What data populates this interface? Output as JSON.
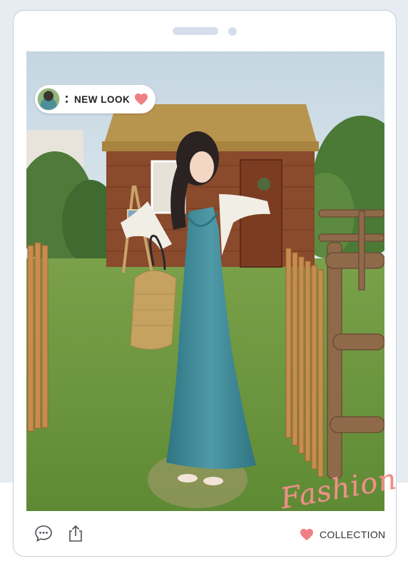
{
  "post": {
    "tag_text": "NEW LOOK",
    "script_word": "Fashion",
    "collection_label": "COLLECTION"
  },
  "icons": {
    "avatar": "avatar-thumbnail",
    "heart": "heart-icon",
    "comment": "chat-bubble-icon",
    "share": "share-icon"
  },
  "colors": {
    "accent_pink": "#ef7f85",
    "frame_bg": "#e7ecf3",
    "dress_teal": "#3f8a97"
  }
}
